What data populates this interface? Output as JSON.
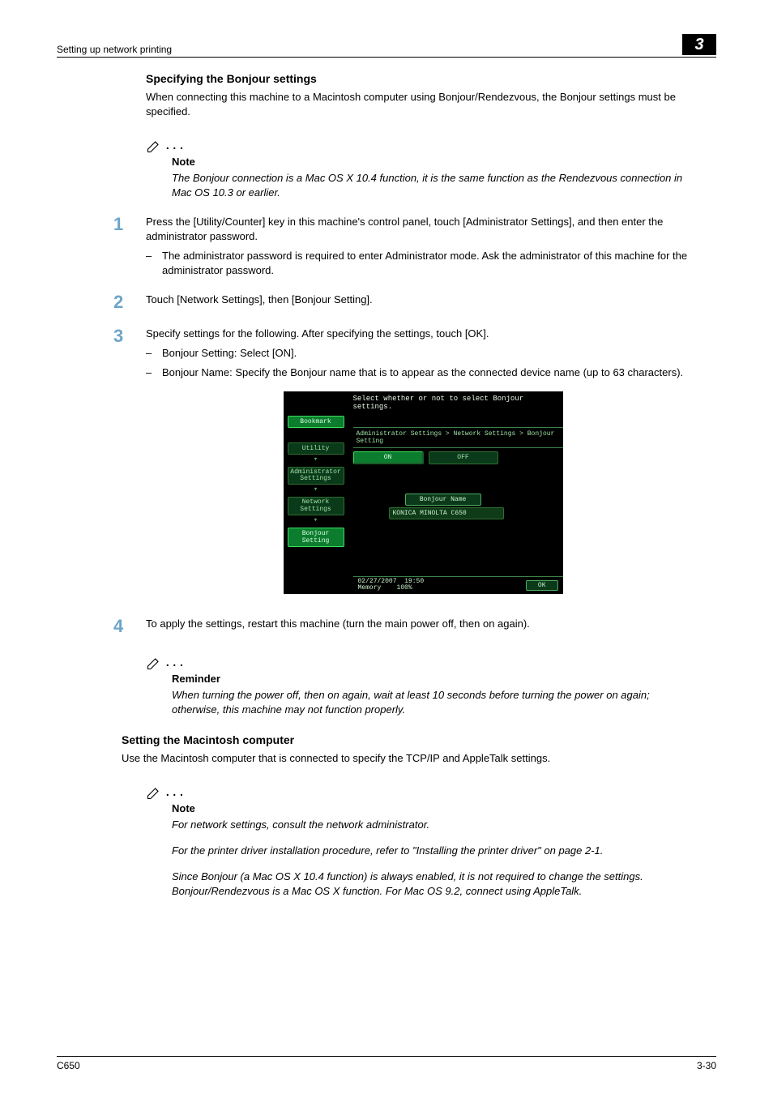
{
  "header": {
    "left": "Setting up network printing",
    "chapter": "3"
  },
  "footer": {
    "left": "C650",
    "right": "3-30"
  },
  "section1": {
    "title": "Specifying the Bonjour settings",
    "intro": "When connecting this machine to a Macintosh computer using Bonjour/Rendezvous, the Bonjour settings must be specified."
  },
  "note1": {
    "title": "Note",
    "body": "The Bonjour connection is a Mac OS X 10.4 function, it is the same function as the Rendezvous connection in Mac OS 10.3 or earlier."
  },
  "steps": {
    "1": {
      "text": "Press the [Utility/Counter] key in this machine's control panel, touch [Administrator Settings], and then enter the administrator password.",
      "sub": [
        "The administrator password is required to enter Administrator mode. Ask the administrator of this machine for the administrator password."
      ]
    },
    "2": {
      "text": "Touch [Network Settings], then [Bonjour Setting]."
    },
    "3": {
      "text": "Specify settings for the following. After specifying the settings, touch [OK].",
      "sub": [
        "Bonjour Setting: Select [ON].",
        "Bonjour Name: Specify the Bonjour name that is to appear as the connected device name (up to 63 characters)."
      ]
    },
    "4": {
      "text": "To apply the settings, restart this machine (turn the main power off, then on again)."
    }
  },
  "screenshot": {
    "prompt": "Select whether or not to select Bonjour settings.",
    "breadcrumb": "Administrator Settings > Network Settings > Bonjour Setting",
    "left_buttons": {
      "bookmark": "Bookmark",
      "utility": "Utility",
      "admin": "Administrator Settings",
      "network": "Network Settings",
      "bonjour": "Bonjour Setting"
    },
    "toggle": {
      "on": "ON",
      "off": "OFF"
    },
    "field_label": "Bonjour Name",
    "field_value": "KONICA MINOLTA C650",
    "datetime": {
      "date": "02/27/2007",
      "time": "19:50",
      "mem_label": "Memory",
      "mem_value": "100%"
    },
    "ok": "OK"
  },
  "reminder": {
    "title": "Reminder",
    "body": "When turning the power off, then on again, wait at least 10 seconds before turning the power on again; otherwise, this machine may not function properly."
  },
  "section2": {
    "title": "Setting the Macintosh computer",
    "intro": "Use the Macintosh computer that is connected to specify the TCP/IP and AppleTalk settings."
  },
  "note2": {
    "title": "Note",
    "p1": "For network settings, consult the network administrator.",
    "p2": "For the printer driver installation procedure, refer to \"Installing the printer driver\" on page 2-1.",
    "p3": "Since Bonjour (a Mac OS X 10.4 function) is always enabled, it is not required to change the settings. Bonjour/Rendezvous is a Mac OS X function. For Mac OS 9.2, connect using AppleTalk."
  }
}
